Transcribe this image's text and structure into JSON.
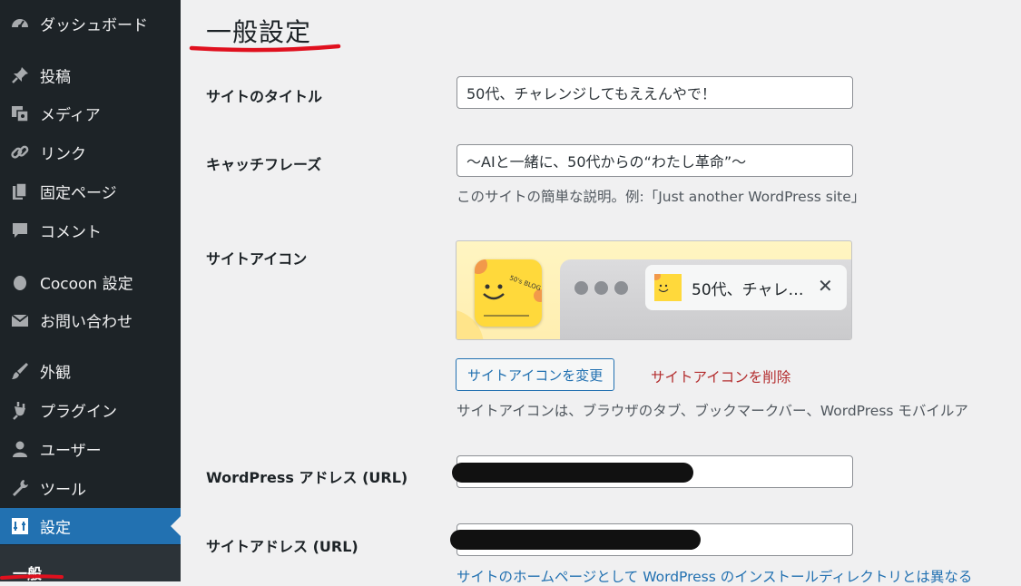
{
  "sidebar": {
    "items": [
      {
        "label": "ダッシュボード",
        "icon": "dashboard-icon"
      },
      {
        "label": "投稿",
        "icon": "pin-icon"
      },
      {
        "label": "メディア",
        "icon": "media-icon"
      },
      {
        "label": "リンク",
        "icon": "link-icon"
      },
      {
        "label": "固定ページ",
        "icon": "page-icon"
      },
      {
        "label": "コメント",
        "icon": "comment-icon"
      },
      {
        "label": "Cocoon 設定",
        "icon": "cocoon-icon"
      },
      {
        "label": "お問い合わせ",
        "icon": "mail-icon"
      },
      {
        "label": "外観",
        "icon": "brush-icon"
      },
      {
        "label": "プラグイン",
        "icon": "plugin-icon"
      },
      {
        "label": "ユーザー",
        "icon": "user-icon"
      },
      {
        "label": "ツール",
        "icon": "wrench-icon"
      },
      {
        "label": "設定",
        "icon": "settings-icon"
      }
    ],
    "submenu_current": "一般"
  },
  "page": {
    "title": "一般設定"
  },
  "fields": {
    "site_title": {
      "label": "サイトのタイトル",
      "value": "50代、チャレンジしてもええんやで！"
    },
    "tagline": {
      "label": "キャッチフレーズ",
      "value": "〜AIと一緒に、50代からの“わたし革命”〜",
      "description": "このサイトの簡単な説明。例:「Just another WordPress site」"
    },
    "site_icon": {
      "label": "サイトアイコン",
      "tab_title": "50代、チャレ…",
      "icon_text": "50's BLOG YUZURO",
      "change_button": "サイトアイコンを変更",
      "remove_link": "サイトアイコンを削除",
      "description": "サイトアイコンは、ブラウザのタブ、ブックマークバー、WordPress モバイルア"
    },
    "wp_address": {
      "label": "WordPress アドレス (URL)"
    },
    "site_address": {
      "label": "サイトアドレス (URL)",
      "description": "サイトのホームページとして WordPress のインストールディレクトリとは異なる"
    }
  },
  "colors": {
    "sidebar_bg": "#1d2327",
    "active": "#2271b1",
    "link": "#2271b1",
    "danger": "#b32d2e",
    "annotation": "#e0101e"
  }
}
